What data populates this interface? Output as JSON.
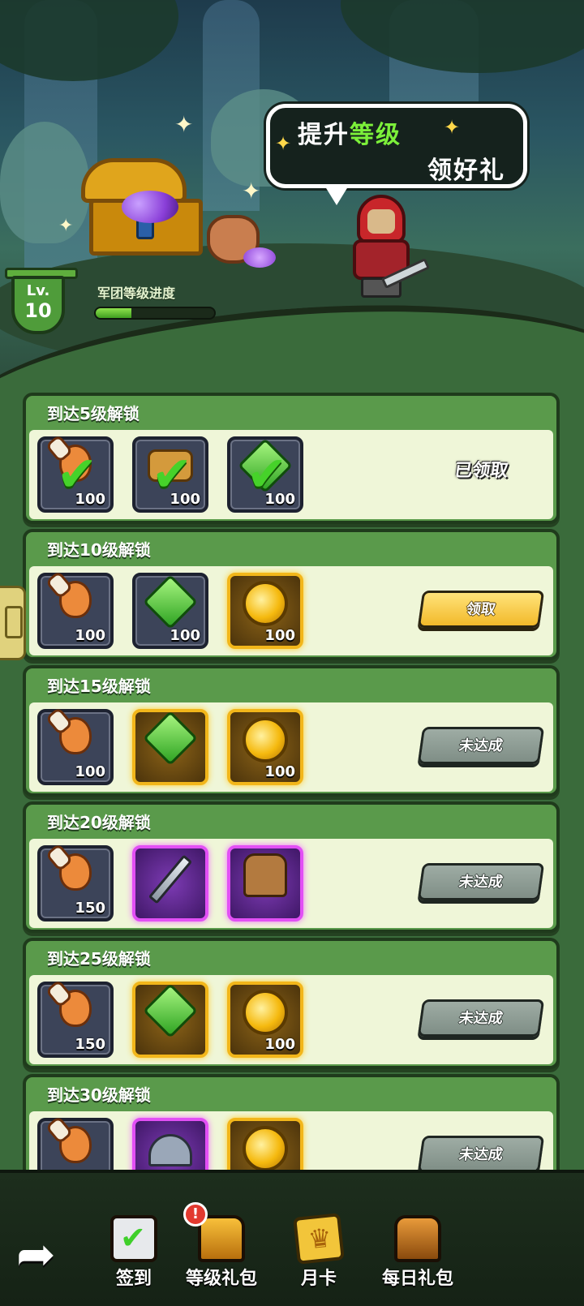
{
  "banner": {
    "speech_line1_pre": "提升",
    "speech_line1_highlight": "等级",
    "speech_line2": "领好礼",
    "level_label": "Lv.",
    "level_value": "10",
    "progress_label": "军团等级进度",
    "progress_fraction": 0.3
  },
  "tiers": [
    {
      "title": "到达5级解锁",
      "status": "已领取",
      "state": "claimed",
      "items": [
        {
          "icon": "meat",
          "qty": "100",
          "rarity": "normal",
          "checked": true
        },
        {
          "icon": "wood",
          "qty": "100",
          "rarity": "normal",
          "checked": true
        },
        {
          "icon": "gem",
          "qty": "100",
          "rarity": "normal",
          "checked": true
        }
      ]
    },
    {
      "title": "到达10级解锁",
      "status": "领取",
      "state": "claim",
      "items": [
        {
          "icon": "meat",
          "qty": "100",
          "rarity": "normal"
        },
        {
          "icon": "gem",
          "qty": "100",
          "rarity": "normal"
        },
        {
          "icon": "coin",
          "qty": "100",
          "rarity": "gold"
        }
      ]
    },
    {
      "title": "到达15级解锁",
      "status": "未达成",
      "state": "locked",
      "items": [
        {
          "icon": "meat",
          "qty": "100",
          "rarity": "normal"
        },
        {
          "icon": "gem",
          "qty": "",
          "rarity": "gold"
        },
        {
          "icon": "coin",
          "qty": "100",
          "rarity": "gold"
        }
      ]
    },
    {
      "title": "到达20级解锁",
      "status": "未达成",
      "state": "locked",
      "items": [
        {
          "icon": "meat",
          "qty": "150",
          "rarity": "normal"
        },
        {
          "icon": "sword",
          "qty": "",
          "rarity": "purple"
        },
        {
          "icon": "armor",
          "qty": "",
          "rarity": "purple"
        }
      ]
    },
    {
      "title": "到达25级解锁",
      "status": "未达成",
      "state": "locked",
      "items": [
        {
          "icon": "meat",
          "qty": "150",
          "rarity": "normal"
        },
        {
          "icon": "gem",
          "qty": "",
          "rarity": "gold"
        },
        {
          "icon": "coin",
          "qty": "100",
          "rarity": "gold"
        }
      ]
    },
    {
      "title": "到达30级解锁",
      "status": "未达成",
      "state": "locked",
      "items": [
        {
          "icon": "meat",
          "qty": "",
          "rarity": "normal"
        },
        {
          "icon": "helm",
          "qty": "",
          "rarity": "purple"
        },
        {
          "icon": "coin",
          "qty": "",
          "rarity": "gold"
        }
      ]
    }
  ],
  "bottom_nav": {
    "items": [
      {
        "label": "签到"
      },
      {
        "label": "等级礼包"
      },
      {
        "label": "月卡"
      },
      {
        "label": "每日礼包"
      }
    ],
    "alert": "!"
  }
}
